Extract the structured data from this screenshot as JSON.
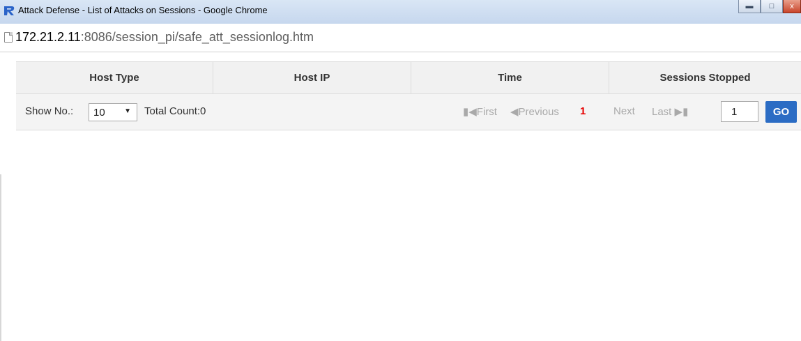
{
  "window": {
    "title": "Attack Defense - List of Attacks on Sessions - Google Chrome",
    "logo_icon": "r-logo-icon",
    "controls": {
      "minimize": "minimize-icon",
      "maximize": "maximize-icon",
      "close": "close-icon"
    }
  },
  "address": {
    "host": "172.21.2.11",
    "rest": ":8086/session_pi/safe_att_sessionlog.htm",
    "page_icon": "document-icon"
  },
  "table": {
    "columns": [
      "Host Type",
      "Host IP",
      "Time",
      "Sessions Stopped"
    ],
    "rows": []
  },
  "toolbar": {
    "show_label": "Show No.:",
    "page_size": "10",
    "total_label": "Total Count:0",
    "first": "First",
    "previous": "Previous",
    "current_page": "1",
    "next": "Next",
    "last": "Last",
    "page_input": "1",
    "go_label": "GO"
  },
  "colors": {
    "current_page": "#e60000",
    "go_button": "#2b6cc4",
    "disabled_text": "#a9a9a9"
  }
}
